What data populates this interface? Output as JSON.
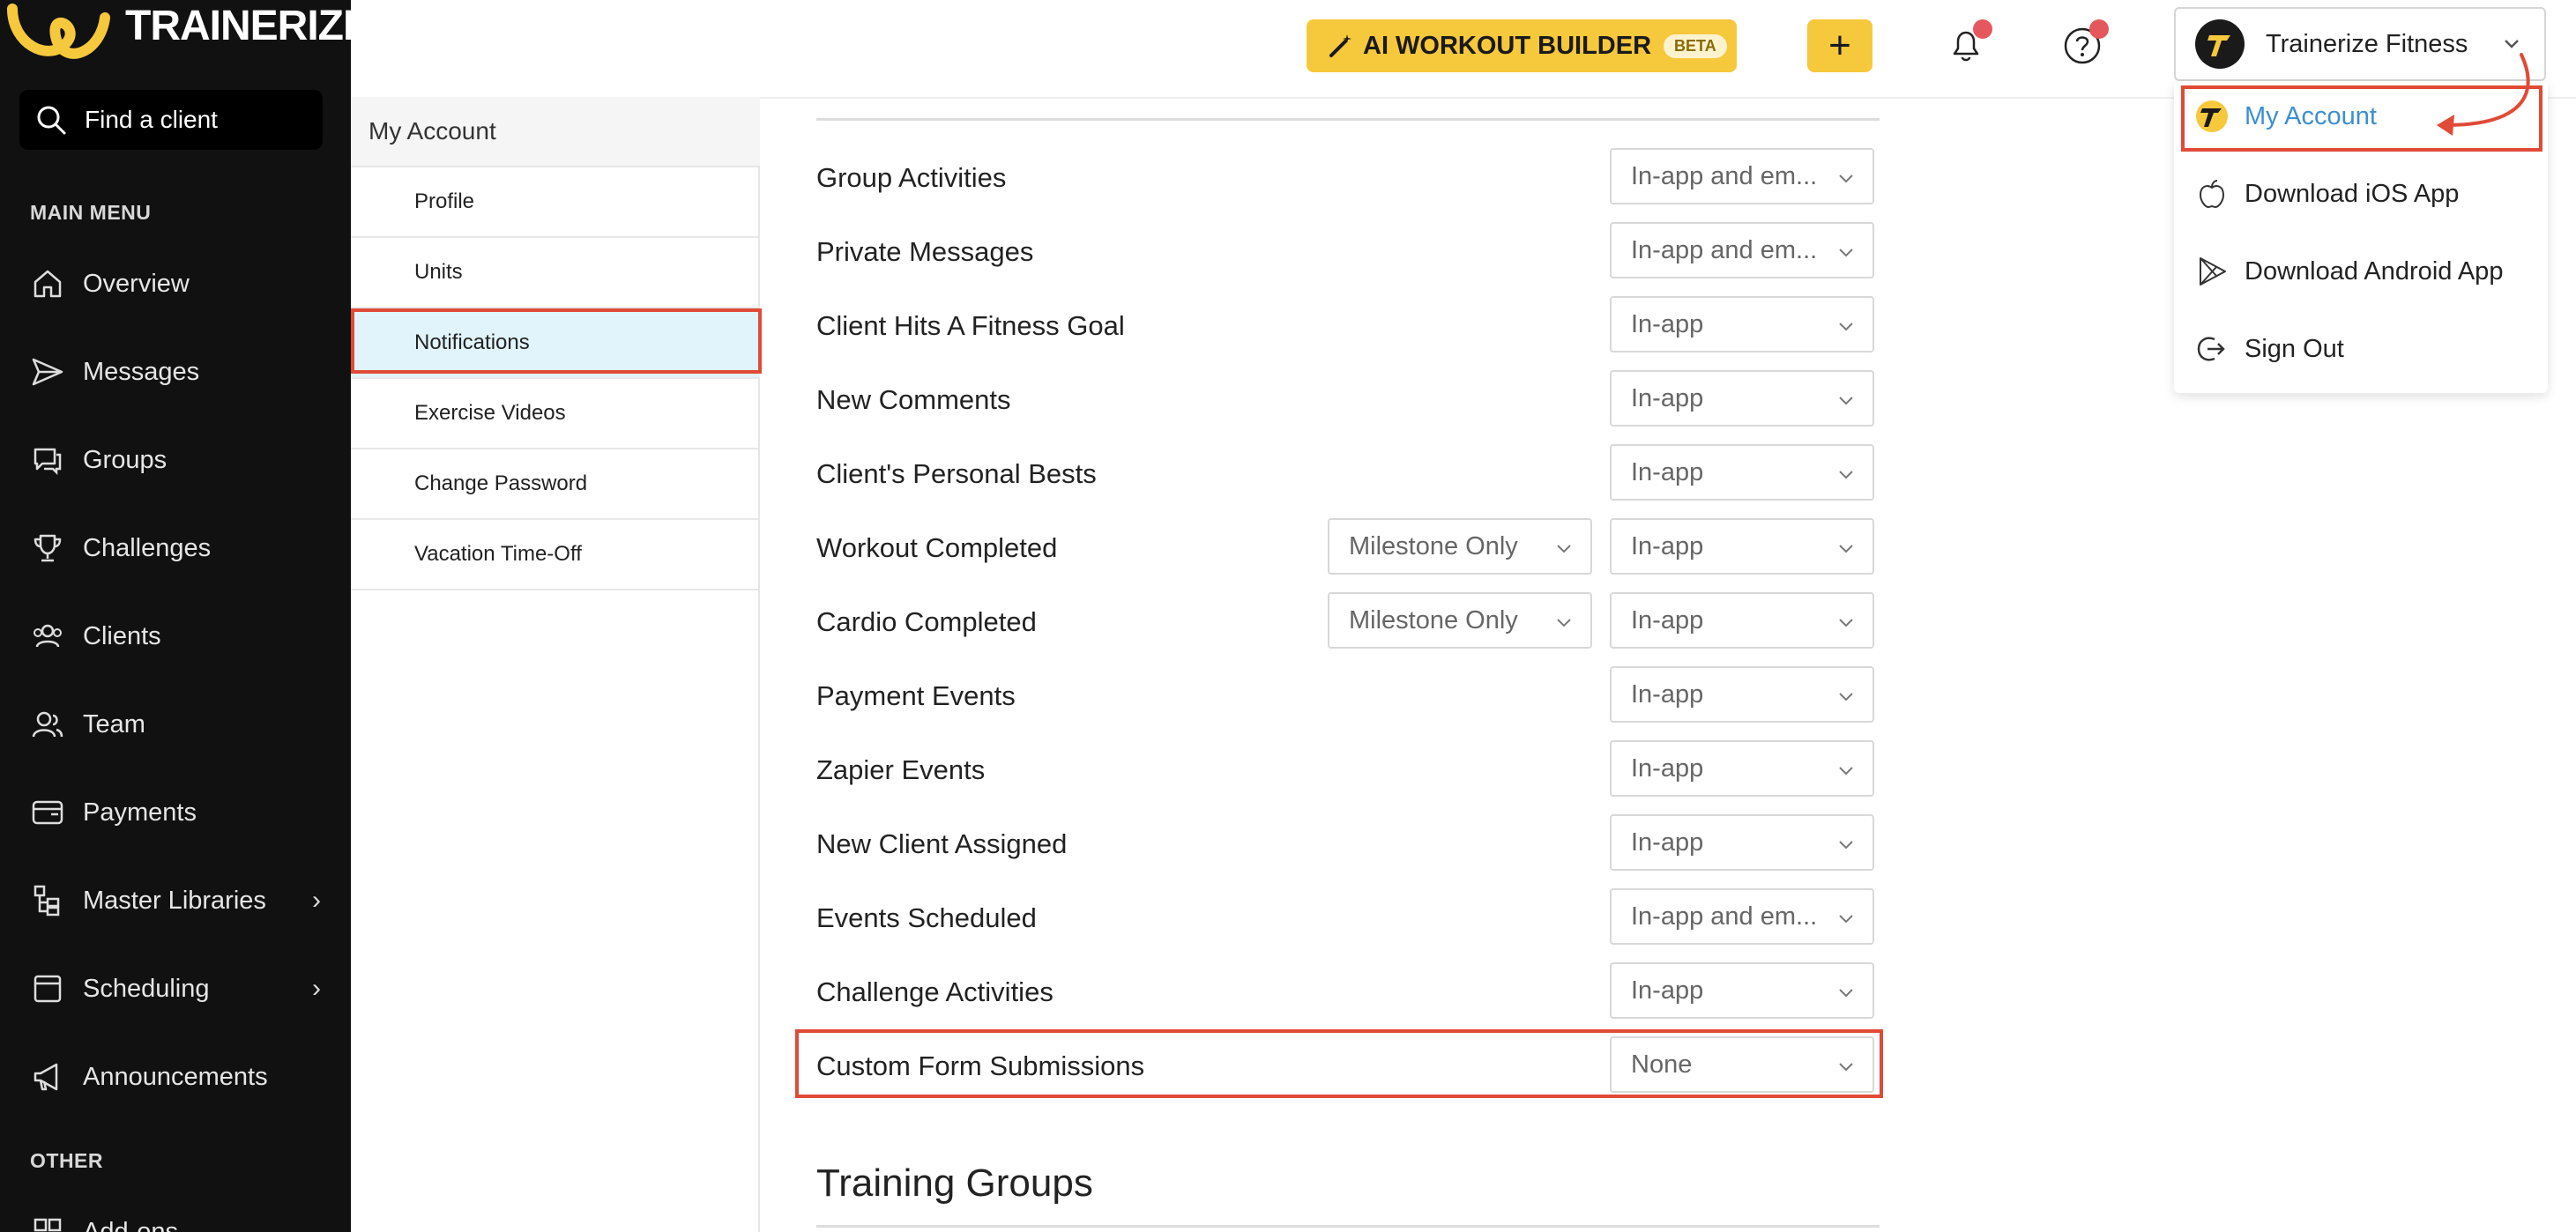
{
  "brand": {
    "logo_text": "TRAINERIZE",
    "accent": "#f6c83c",
    "sidebar_bg": "#111111",
    "highlight": "#e04a36"
  },
  "search": {
    "label": "Find a client"
  },
  "sidebar": {
    "main_menu_label": "MAIN MENU",
    "other_label": "OTHER",
    "items": [
      {
        "label": "Overview",
        "icon": "home-icon"
      },
      {
        "label": "Messages",
        "icon": "send-icon"
      },
      {
        "label": "Groups",
        "icon": "chat-icon"
      },
      {
        "label": "Challenges",
        "icon": "trophy-icon"
      },
      {
        "label": "Clients",
        "icon": "users-icon"
      },
      {
        "label": "Team",
        "icon": "team-icon"
      },
      {
        "label": "Payments",
        "icon": "wallet-icon"
      },
      {
        "label": "Master Libraries",
        "icon": "library-icon"
      },
      {
        "label": "Scheduling",
        "icon": "calendar-icon"
      },
      {
        "label": "Announcements",
        "icon": "megaphone-icon"
      }
    ],
    "partial_item": "Add-ons"
  },
  "topbar": {
    "ai_button": "AI WORKOUT BUILDER",
    "ai_badge": "BETA",
    "plus": "+",
    "account_name": "Trainerize Fitness"
  },
  "dropdown": {
    "items": [
      {
        "label": "My Account",
        "icon": "avatar-icon"
      },
      {
        "label": "Download iOS App",
        "icon": "apple-icon"
      },
      {
        "label": "Download Android App",
        "icon": "play-store-icon"
      },
      {
        "label": "Sign Out",
        "icon": "sign-out-icon"
      }
    ]
  },
  "subnav": {
    "header": "My Account",
    "items": [
      "Profile",
      "Units",
      "Notifications",
      "Exercise Videos",
      "Change Password",
      "Vacation Time-Off"
    ],
    "active": "Notifications"
  },
  "notifications": [
    {
      "label": "Group Activities",
      "value": "In-app and em..."
    },
    {
      "label": "Private Messages",
      "value": "In-app and em..."
    },
    {
      "label": "Client Hits A Fitness Goal",
      "value": "In-app"
    },
    {
      "label": "New Comments",
      "value": "In-app"
    },
    {
      "label": "Client's Personal Bests",
      "value": "In-app"
    },
    {
      "label": "Workout Completed",
      "value": "In-app",
      "filter": "Milestone Only"
    },
    {
      "label": "Cardio Completed",
      "value": "In-app",
      "filter": "Milestone Only"
    },
    {
      "label": "Payment Events",
      "value": "In-app"
    },
    {
      "label": "Zapier Events",
      "value": "In-app"
    },
    {
      "label": "New Client Assigned",
      "value": "In-app"
    },
    {
      "label": "Events Scheduled",
      "value": "In-app and em..."
    },
    {
      "label": "Challenge Activities",
      "value": "In-app"
    },
    {
      "label": "Custom Form Submissions",
      "value": "None"
    }
  ],
  "next_section": "Training Groups"
}
